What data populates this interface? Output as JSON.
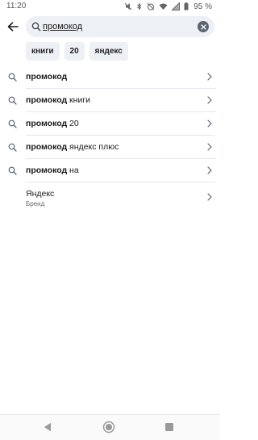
{
  "status_bar": {
    "time": "11:20",
    "battery": "95 %"
  },
  "search": {
    "value": "промокод",
    "placeholder": ""
  },
  "chips": [
    {
      "label": "книги"
    },
    {
      "label": "20"
    },
    {
      "label": "яндекс"
    }
  ],
  "suggestions": [
    {
      "bold": "промокод",
      "rest": ""
    },
    {
      "bold": "промокод",
      "rest": " книги"
    },
    {
      "bold": "промокод",
      "rest": " 20"
    },
    {
      "bold": "промокод",
      "rest": " яндекс плюс"
    },
    {
      "bold": "промокод",
      "rest": " на"
    }
  ],
  "brand": {
    "title": "Яндекс",
    "subtitle": "Бренд"
  },
  "icons": {
    "back": "arrow-left-icon",
    "search": "search-icon",
    "clear": "clear-icon",
    "chevron": "chevron-right-icon"
  },
  "colors": {
    "search_bg": "#edf0f4",
    "clear_bg": "#5a6470",
    "divider": "#e3e6ea"
  }
}
